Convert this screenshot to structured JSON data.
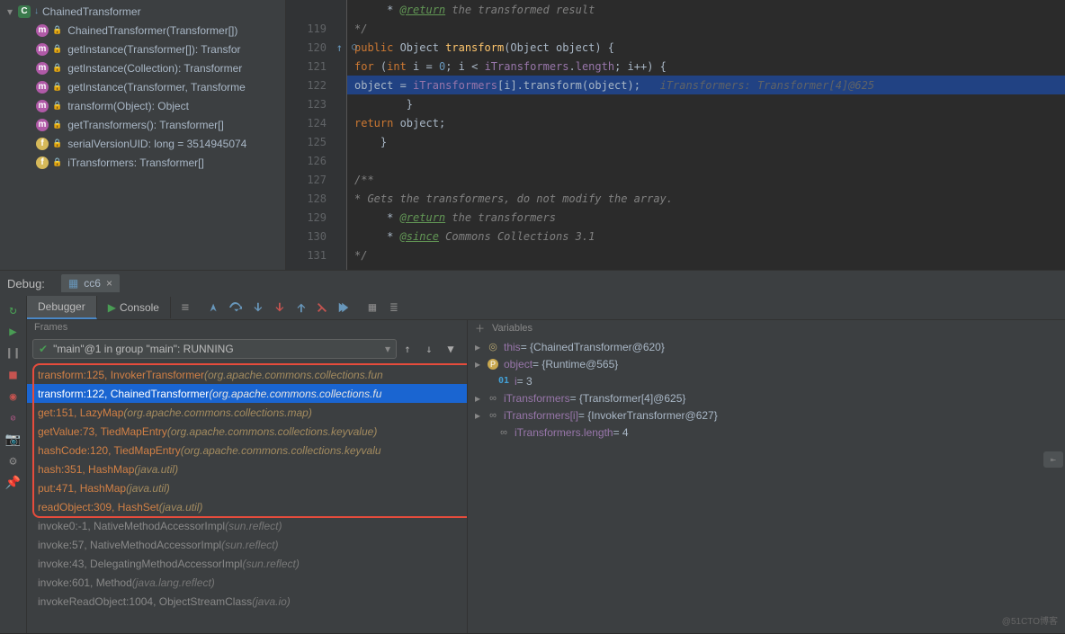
{
  "tree": {
    "root": "ChainedTransformer",
    "items": [
      {
        "icon": "m",
        "label": "ChainedTransformer(Transformer[])"
      },
      {
        "icon": "m",
        "label": "getInstance(Transformer[]): Transfor"
      },
      {
        "icon": "m",
        "label": "getInstance(Collection): Transformer"
      },
      {
        "icon": "m",
        "label": "getInstance(Transformer, Transforme"
      },
      {
        "icon": "m",
        "label": "transform(Object): Object"
      },
      {
        "icon": "m",
        "label": "getTransformers(): Transformer[]"
      },
      {
        "icon": "f",
        "label": "serialVersionUID: long = 3514945074"
      },
      {
        "icon": "f",
        "label": "iTransformers: Transformer[]"
      }
    ]
  },
  "code": {
    "lines": [
      {
        "n": "",
        "html": "     * <span class='tag-u'>@return</span><span class='cmt'> the transformed result</span>"
      },
      {
        "n": "119",
        "html": "     <span class='cmt'>*/</span>"
      },
      {
        "n": "120",
        "arrow": "↑",
        "overr": "◯↑",
        "html": "    <span class='kw'>public </span><span class='ident'>Object </span><span class='method-call'>transform</span>(<span class='ident'>Object </span><span class='param'>object</span>) {"
      },
      {
        "n": "121",
        "html": "        <span class='kw'>for </span>(<span class='kw'>int </span><span class='ident'>i</span> = <span class='num'>0</span>; <span class='ident'>i</span> &lt; <span class='field'>iTransformers</span>.<span class='field'>length</span>; <span class='ident'>i</span>++) {"
      },
      {
        "n": "122",
        "cur": true,
        "html": "            <span class='param'>object</span> = <span class='field'>iTransformers</span>[<span class='ident'>i</span>].transform(<span class='param'>object</span>);   <span class='str-hint'>iTransformers: Transformer[4]@625</span>"
      },
      {
        "n": "123",
        "html": "        }"
      },
      {
        "n": "124",
        "html": "        <span class='kw'>return </span><span class='param'>object</span>;"
      },
      {
        "n": "125",
        "html": "    }"
      },
      {
        "n": "126",
        "html": ""
      },
      {
        "n": "127",
        "html": "    <span class='cmt'>/**</span>"
      },
      {
        "n": "128",
        "html": "     <span class='cmt'>* Gets the transformers, do not modify the array.</span>"
      },
      {
        "n": "129",
        "html": "     * <span class='tag-u'>@return</span><span class='cmt'> the transformers</span>"
      },
      {
        "n": "130",
        "html": "     * <span class='tag-u'>@since</span><span class='cmt'> Commons Collections 3.1</span>"
      },
      {
        "n": "131",
        "html": "     <span class='cmt'>*/</span>"
      }
    ]
  },
  "debug": {
    "label": "Debug:",
    "tab": "cc6",
    "tabs": {
      "debugger": "Debugger",
      "console": "Console"
    },
    "framesTitle": "Frames",
    "varsTitle": "Variables",
    "thread": "\"main\"@1 in group \"main\": RUNNING",
    "frames": [
      {
        "main": "transform:125, InvokerTransformer ",
        "ital": "(org.apache.commons.collections.fun"
      },
      {
        "main": "transform:122, ChainedTransformer ",
        "ital": "(org.apache.commons.collections.fu",
        "sel": true
      },
      {
        "main": "get:151, LazyMap ",
        "ital": "(org.apache.commons.collections.map)"
      },
      {
        "main": "getValue:73, TiedMapEntry ",
        "ital": "(org.apache.commons.collections.keyvalue)"
      },
      {
        "main": "hashCode:120, TiedMapEntry ",
        "ital": "(org.apache.commons.collections.keyvalu"
      },
      {
        "main": "hash:351, HashMap ",
        "ital": "(java.util)"
      },
      {
        "main": "put:471, HashMap ",
        "ital": "(java.util)"
      },
      {
        "main": "readObject:309, HashSet ",
        "ital": "(java.util)"
      },
      {
        "main": "invoke0:-1, NativeMethodAccessorImpl ",
        "ital": "(sun.reflect)",
        "dim": true
      },
      {
        "main": "invoke:57, NativeMethodAccessorImpl ",
        "ital": "(sun.reflect)",
        "dim": true
      },
      {
        "main": "invoke:43, DelegatingMethodAccessorImpl ",
        "ital": "(sun.reflect)",
        "dim": true
      },
      {
        "main": "invoke:601, Method ",
        "ital": "(java.lang.reflect)",
        "dim": true
      },
      {
        "main": "invokeReadObject:1004, ObjectStreamClass ",
        "ital": "(java.io)",
        "dim": true
      }
    ],
    "vars": [
      {
        "tog": "▸",
        "ico": "ring",
        "k": "this",
        "v": " = {ChainedTransformer@620}"
      },
      {
        "tog": "▸",
        "ico": "p",
        "k": "object",
        "v": " = {Runtime@565}"
      },
      {
        "tog": "",
        "ico": "num",
        "k": "i",
        "v": " = 3",
        "indent": true
      },
      {
        "tog": "▸",
        "ico": "inf",
        "k": "iTransformers",
        "v": " = {Transformer[4]@625}"
      },
      {
        "tog": "▸",
        "ico": "inf",
        "k": "iTransformers[i]",
        "v": " = {InvokerTransformer@627}"
      },
      {
        "tog": "",
        "ico": "inf",
        "k": "iTransformers.length",
        "v": " = 4",
        "indent": true
      }
    ]
  },
  "watermark": "@51CTO博客"
}
